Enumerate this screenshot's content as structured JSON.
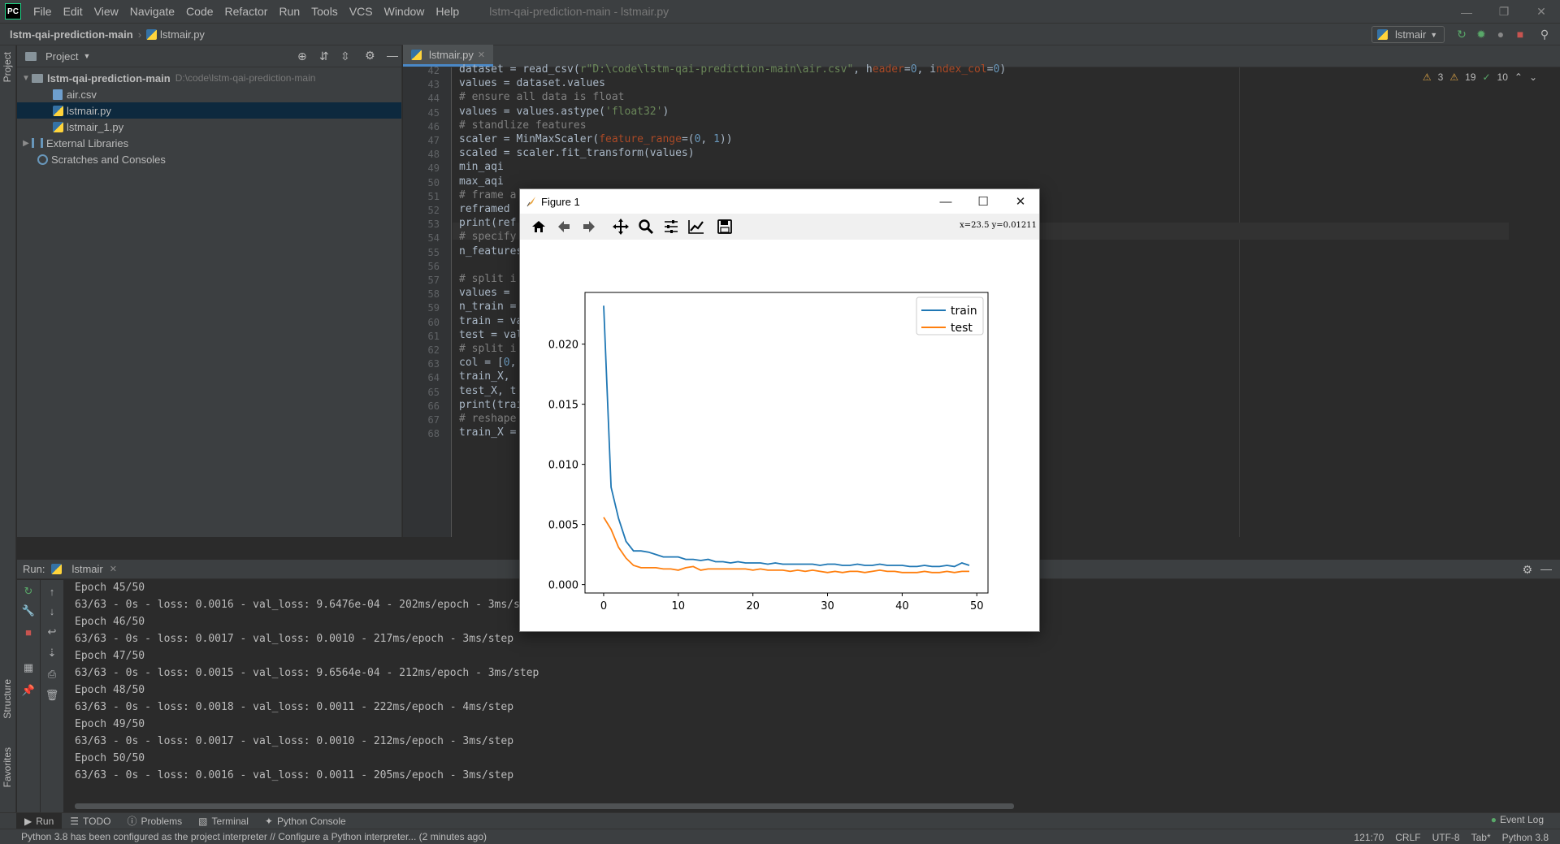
{
  "app": {
    "logo_text": "PC",
    "window_title": "lstm-qai-prediction-main - lstmair.py"
  },
  "menu": [
    "File",
    "Edit",
    "View",
    "Navigate",
    "Code",
    "Refactor",
    "Run",
    "Tools",
    "VCS",
    "Window",
    "Help"
  ],
  "navbar": {
    "project": "lstm-qai-prediction-main",
    "file": "lstmair.py",
    "run_config": "lstmair"
  },
  "left_strip": {
    "project_tab": "Project",
    "structure_tab": "Structure",
    "favorites_tab": "Favorites"
  },
  "project_panel": {
    "title": "Project",
    "root": {
      "name": "lstm-qai-prediction-main",
      "path": "D:\\code\\lstm-qai-prediction-main"
    },
    "files": [
      {
        "name": "air.csv",
        "type": "csv"
      },
      {
        "name": "lstmair.py",
        "type": "py"
      },
      {
        "name": "lstmair_1.py",
        "type": "py"
      }
    ],
    "external_libraries": "External Libraries",
    "scratches": "Scratches and Consoles"
  },
  "editor": {
    "tab": "lstmair.py",
    "inspections": {
      "warnings": "3",
      "weak_warnings": "19",
      "ok": "10"
    },
    "lines": [
      {
        "num": "42",
        "code": "dataset = read_csv(r\"D:\\code\\lstm-qai-prediction-main\\air.csv\", header=0, index_col=0)"
      },
      {
        "num": "43",
        "code": "values = dataset.values"
      },
      {
        "num": "44",
        "code": "# ensure all data is float"
      },
      {
        "num": "45",
        "code": "values = values.astype('float32')"
      },
      {
        "num": "46",
        "code": "# standlize features"
      },
      {
        "num": "47",
        "code": "scaler = MinMaxScaler(feature_range=(0, 1))"
      },
      {
        "num": "48",
        "code": "scaled = scaler.fit_transform(values)"
      },
      {
        "num": "49",
        "code": "min_aqi"
      },
      {
        "num": "50",
        "code": "max_aqi"
      },
      {
        "num": "51",
        "code": "# frame a"
      },
      {
        "num": "52",
        "code": "reframed"
      },
      {
        "num": "53",
        "code": "print(ref"
      },
      {
        "num": "54",
        "code": "# specify"
      },
      {
        "num": "55",
        "code": "n_features"
      },
      {
        "num": "56",
        "code": ""
      },
      {
        "num": "57",
        "code": "# split i"
      },
      {
        "num": "58",
        "code": "values = "
      },
      {
        "num": "59",
        "code": "n_train ="
      },
      {
        "num": "60",
        "code": "train = va"
      },
      {
        "num": "61",
        "code": "test = val"
      },
      {
        "num": "62",
        "code": "# split i"
      },
      {
        "num": "63",
        "code": "col = [0,"
      },
      {
        "num": "64",
        "code": "train_X, "
      },
      {
        "num": "65",
        "code": "test_X, t"
      },
      {
        "num": "66",
        "code": "print(trai"
      },
      {
        "num": "67",
        "code": "# reshape"
      },
      {
        "num": "68",
        "code": "train_X ="
      }
    ]
  },
  "run_panel": {
    "label": "Run:",
    "tab": "lstmair",
    "console": [
      "Epoch 45/50",
      "63/63 - 0s - loss: 0.0016 - val_loss: 9.6476e-04 - 202ms/epoch - 3ms/step",
      "Epoch 46/50",
      "63/63 - 0s - loss: 0.0017 - val_loss: 0.0010 - 217ms/epoch - 3ms/step",
      "Epoch 47/50",
      "63/63 - 0s - loss: 0.0015 - val_loss: 9.6564e-04 - 212ms/epoch - 3ms/step",
      "Epoch 48/50",
      "63/63 - 0s - loss: 0.0018 - val_loss: 0.0011 - 222ms/epoch - 4ms/step",
      "Epoch 49/50",
      "63/63 - 0s - loss: 0.0017 - val_loss: 0.0010 - 212ms/epoch - 3ms/step",
      "Epoch 50/50",
      "63/63 - 0s - loss: 0.0016 - val_loss: 0.0011 - 205ms/epoch - 3ms/step"
    ]
  },
  "bottom_tabs": [
    "Run",
    "TODO",
    "Problems",
    "Terminal",
    "Python Console"
  ],
  "event_log": "Event Log",
  "status": {
    "message": "Python 3.8 has been configured as the project interpreter // Configure a Python interpreter... (2 minutes ago)",
    "position": "121:70",
    "line_sep": "CRLF",
    "encoding": "UTF-8",
    "indent": "Tab*",
    "interpreter": "Python 3.8"
  },
  "figure": {
    "window_title": "Figure 1",
    "coords": "x=23.5  y=0.01211",
    "tools": [
      "home-icon",
      "back-icon",
      "forward-icon",
      "pan-icon",
      "zoom-icon",
      "subplots-icon",
      "edit-axis-icon",
      "save-icon"
    ]
  },
  "chart_data": {
    "type": "line",
    "title": "",
    "xlabel": "",
    "ylabel": "",
    "xlim": [
      -2.5,
      51.5
    ],
    "ylim": [
      -0.0007,
      0.0243
    ],
    "xticks": [
      0,
      10,
      20,
      30,
      40,
      50
    ],
    "yticks": [
      "0.000",
      "0.005",
      "0.010",
      "0.015",
      "0.020"
    ],
    "legend_position": "top-right",
    "x": [
      0,
      1,
      2,
      3,
      4,
      5,
      6,
      7,
      8,
      9,
      10,
      11,
      12,
      13,
      14,
      15,
      16,
      17,
      18,
      19,
      20,
      21,
      22,
      23,
      24,
      25,
      26,
      27,
      28,
      29,
      30,
      31,
      32,
      33,
      34,
      35,
      36,
      37,
      38,
      39,
      40,
      41,
      42,
      43,
      44,
      45,
      46,
      47,
      48,
      49
    ],
    "series": [
      {
        "name": "train",
        "color": "#1f77b4",
        "values": [
          0.0232,
          0.0081,
          0.0055,
          0.0036,
          0.0028,
          0.0028,
          0.0027,
          0.0025,
          0.0023,
          0.0023,
          0.0023,
          0.0021,
          0.0021,
          0.002,
          0.0021,
          0.0019,
          0.0019,
          0.0018,
          0.0019,
          0.0018,
          0.0018,
          0.0018,
          0.0017,
          0.0018,
          0.0017,
          0.0017,
          0.0017,
          0.0017,
          0.0017,
          0.0016,
          0.0017,
          0.0017,
          0.0016,
          0.0016,
          0.0017,
          0.0016,
          0.0016,
          0.0017,
          0.0016,
          0.0016,
          0.0016,
          0.0015,
          0.0015,
          0.0016,
          0.0015,
          0.0015,
          0.0016,
          0.0015,
          0.0018,
          0.0016
        ]
      },
      {
        "name": "test",
        "color": "#ff7f0e",
        "values": [
          0.0056,
          0.0046,
          0.0031,
          0.0022,
          0.0016,
          0.0014,
          0.0014,
          0.0014,
          0.0013,
          0.0013,
          0.0012,
          0.0014,
          0.0015,
          0.0012,
          0.0013,
          0.0013,
          0.0013,
          0.0013,
          0.0013,
          0.0013,
          0.0012,
          0.0013,
          0.0012,
          0.0012,
          0.0012,
          0.0011,
          0.0012,
          0.0011,
          0.0012,
          0.0011,
          0.001,
          0.0011,
          0.001,
          0.0011,
          0.0011,
          0.001,
          0.0011,
          0.0012,
          0.0011,
          0.0011,
          0.001,
          0.001,
          0.001,
          0.0011,
          0.001,
          0.001,
          0.0011,
          0.001,
          0.0011,
          0.0011
        ]
      }
    ]
  }
}
